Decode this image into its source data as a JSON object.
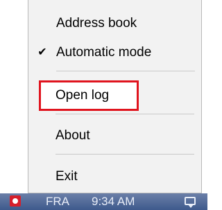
{
  "menu": {
    "items": [
      {
        "label": "Address book",
        "checked": false
      },
      {
        "label": "Automatic mode",
        "checked": true
      },
      {
        "label": "Open log",
        "checked": false,
        "highlighted": true
      },
      {
        "label": "About",
        "checked": false
      },
      {
        "label": "Exit",
        "checked": false
      }
    ],
    "check_glyph": "✔"
  },
  "taskbar": {
    "language": "FRA",
    "time": "9:34 AM",
    "app_icon": "tray-app-icon",
    "notification_icon": "notification-icon"
  },
  "colors": {
    "highlight": "#e0141e",
    "menu_bg": "#f2f2f2",
    "taskbar": "#3e5a8c"
  }
}
